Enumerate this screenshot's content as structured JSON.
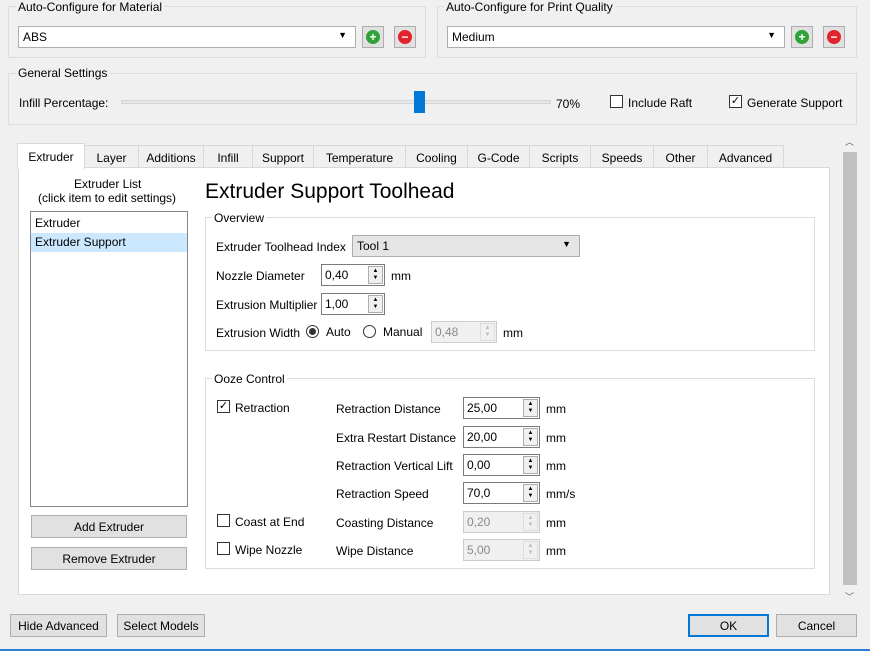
{
  "material": {
    "title": "Auto-Configure for Material",
    "selected": "ABS"
  },
  "quality": {
    "title": "Auto-Configure for Print Quality",
    "selected": "Medium"
  },
  "general": {
    "title": "General Settings",
    "infill_label": "Infill Percentage:",
    "infill_value": "70%",
    "infill_fraction": 0.7,
    "include_raft_label": "Include Raft",
    "include_raft": false,
    "generate_support_label": "Generate Support",
    "generate_support": true
  },
  "tabs": [
    "Extruder",
    "Layer",
    "Additions",
    "Infill",
    "Support",
    "Temperature",
    "Cooling",
    "G-Code",
    "Scripts",
    "Speeds",
    "Other",
    "Advanced"
  ],
  "active_tab": "Extruder",
  "extruder_list": {
    "header_line1": "Extruder List",
    "header_line2": "(click item to edit settings)",
    "items": [
      "Extruder",
      "Extruder Support"
    ],
    "selected_index": 1,
    "add_label": "Add Extruder",
    "remove_label": "Remove Extruder"
  },
  "extruder": {
    "heading": "Extruder Support Toolhead",
    "overview_title": "Overview",
    "toolhead_index_label": "Extruder Toolhead Index",
    "toolhead_index_value": "Tool 1",
    "nozzle_label": "Nozzle Diameter",
    "nozzle_value": "0,40",
    "nozzle_unit": "mm",
    "multiplier_label": "Extrusion Multiplier",
    "multiplier_value": "1,00",
    "width_label": "Extrusion Width",
    "width_auto_label": "Auto",
    "width_manual_label": "Manual",
    "width_value": "0,48",
    "width_unit": "mm",
    "width_mode": "Auto"
  },
  "ooze": {
    "title": "Ooze Control",
    "retraction_label": "Retraction",
    "retraction": true,
    "coast_label": "Coast at End",
    "coast": false,
    "wipe_label": "Wipe Nozzle",
    "wipe": false,
    "fields": [
      {
        "label": "Retraction Distance",
        "value": "25,00",
        "unit": "mm",
        "enabled": true
      },
      {
        "label": "Extra Restart Distance",
        "value": "20,00",
        "unit": "mm",
        "enabled": true
      },
      {
        "label": "Retraction Vertical Lift",
        "value": "0,00",
        "unit": "mm",
        "enabled": true
      },
      {
        "label": "Retraction Speed",
        "value": "70,0",
        "unit": "mm/s",
        "enabled": true
      },
      {
        "label": "Coasting Distance",
        "value": "0,20",
        "unit": "mm",
        "enabled": false
      },
      {
        "label": "Wipe Distance",
        "value": "5,00",
        "unit": "mm",
        "enabled": false
      }
    ]
  },
  "footer": {
    "hide_advanced": "Hide Advanced",
    "select_models": "Select Models",
    "ok": "OK",
    "cancel": "Cancel"
  },
  "colors": {
    "accent": "#0078d7",
    "add": "#2fa33a",
    "remove": "#e0242b",
    "selection": "#cce8ff"
  }
}
